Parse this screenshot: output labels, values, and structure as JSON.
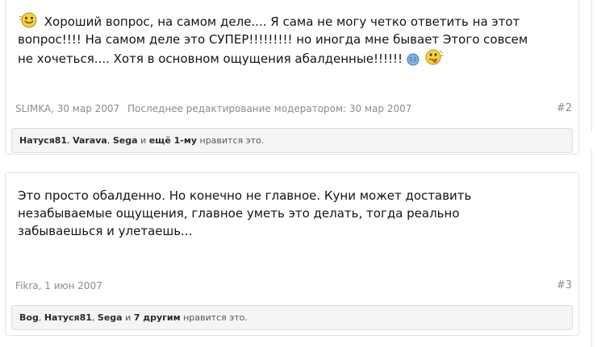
{
  "posts": [
    {
      "text_before": " Хороший вопрос, на самом деле.... Я сама не могу четко ответить на этот вопрос!!!! На самом деле это СУПЕР!!!!!!!!! но иногда мне бывает Этого совсем не хочеться.... Хотя в основном ощущения абалденные!!!!!! ",
      "author": "SLIMKA",
      "date": "30 мар 2007",
      "edit_note": "Последнее редактирование модератором: 30 мар 2007",
      "permalink": "#2",
      "likes": {
        "names": [
          "Натуся81",
          "Varava",
          "Sega"
        ],
        "and_word": "и",
        "more": "ещё 1-му",
        "suffix": "нравится это."
      }
    },
    {
      "text_before": "Это просто обалденно. Но конечно не главное. Куни может доставить незабываемые ощущения, главное уметь это делать, тогда реально забываешься и улетаешь...",
      "author": "Fikra",
      "date": "1 июн 2007",
      "permalink": "#3",
      "likes": {
        "names": [
          "Bog",
          "Натуся81",
          "Sega"
        ],
        "and_word": "и",
        "more": "7 другим",
        "suffix": "нравится это."
      }
    }
  ],
  "icons": {
    "smiley_start": "grinning-yellow-smiley-icon",
    "smiley_blue": "blue-laughing-smiley-icon",
    "smiley_end": "tongue-out-smiley-icon"
  }
}
